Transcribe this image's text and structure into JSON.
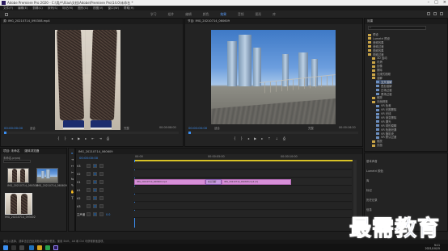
{
  "window": {
    "title": "Adobe Premiere Pro 2020 - C:\\用户\\Xiao\\文档\\Adobe\\Premiere Pro\\14.0\\未命名 *"
  },
  "menu": [
    "文件(F)",
    "编辑(E)",
    "剪辑(C)",
    "序列(S)",
    "标记(M)",
    "图形(G)",
    "视图(V)",
    "窗口(W)",
    "帮助(H)"
  ],
  "workspaces": {
    "tabs": [
      "学习",
      "组件",
      "编辑",
      "颜色",
      "效果",
      "音频",
      "图形",
      "库"
    ],
    "active_index": 4
  },
  "source_monitor": {
    "header": "源: IMG_20210714_090308.mp4",
    "timecode": "00:00:00:00",
    "fit_label": "适合",
    "quality_label": "完整",
    "duration": "00:00:08:00",
    "accent": "#3b8ef0"
  },
  "program_monitor": {
    "header": "节目: IMG_20210714_060609",
    "timecode": "00:00:00:00",
    "fit_label": "适合",
    "quality_label": "完整",
    "duration": "00:00:16:20"
  },
  "project_panel": {
    "tabs": [
      "项目: 未命名",
      "媒体浏览器"
    ],
    "path": "未命名.prproj",
    "items": [
      {
        "name": "IMG_20210714_060609",
        "duration": "9:08"
      },
      {
        "name": "IMG_20210714_090308",
        "duration": "8:00"
      },
      {
        "name": "IMG_20210714_093002",
        "duration": "6:20"
      }
    ]
  },
  "tools": [
    "▸",
    "⇥",
    "↔",
    "✂",
    "⇆",
    "✎",
    "✋",
    "T"
  ],
  "timeline": {
    "tab": "IMG_20210714_060609",
    "timecode": "00:00:00:00",
    "ruler_labels": [
      "00:00",
      "00:00:05:00",
      "00:00:10:00"
    ],
    "tracks": [
      {
        "label": "V3",
        "type": "video"
      },
      {
        "label": "V2",
        "type": "video"
      },
      {
        "label": "V1",
        "type": "video"
      },
      {
        "label": "A1",
        "type": "audio"
      },
      {
        "label": "A2",
        "type": "audio"
      },
      {
        "label": "A3",
        "type": "audio"
      },
      {
        "label": "主声道",
        "type": "master",
        "value": "0.0"
      }
    ],
    "clips": [
      {
        "track": "V1",
        "name": "IMG_20210714_060609.mp4"
      },
      {
        "track": "V1",
        "name": "交叉溶解"
      },
      {
        "track": "V1",
        "name": "IMG_20210714_090308.mp4 [V]"
      }
    ],
    "clip_color": "#d78fd8"
  },
  "effects_panel": {
    "header": "效果",
    "items": [
      {
        "label": "预设",
        "depth": 0
      },
      {
        "label": "Lumetri 预设",
        "depth": 0
      },
      {
        "label": "音频效果",
        "depth": 0
      },
      {
        "label": "音频过渡",
        "depth": 0
      },
      {
        "label": "视频效果",
        "depth": 0
      },
      {
        "label": "视频过渡",
        "depth": 0
      },
      {
        "label": "3D 运动",
        "depth": 1
      },
      {
        "label": "内滑",
        "depth": 1
      },
      {
        "label": "划像",
        "depth": 1
      },
      {
        "label": "擦除",
        "depth": 1
      },
      {
        "label": "沉浸式视频",
        "depth": 1
      },
      {
        "label": "溶解",
        "depth": 1
      },
      {
        "label": "交叉溶解",
        "depth": 2,
        "selected": true
      },
      {
        "label": "叠加溶解",
        "depth": 2
      },
      {
        "label": "白场过渡",
        "depth": 2
      },
      {
        "label": "黑场过渡",
        "depth": 2
      },
      {
        "label": "缩放",
        "depth": 1
      },
      {
        "label": "页面剥落",
        "depth": 1
      },
      {
        "label": "VR 色差",
        "depth": 2
      },
      {
        "label": "VR 光圈擦除",
        "depth": 2
      },
      {
        "label": "VR 光线",
        "depth": 2
      },
      {
        "label": "VR 渐变擦除",
        "depth": 2
      },
      {
        "label": "VR 漏光",
        "depth": 2
      },
      {
        "label": "VR 球形模糊",
        "depth": 2
      },
      {
        "label": "VR 色度泄漏",
        "depth": 2
      },
      {
        "label": "VR 随机块",
        "depth": 2
      },
      {
        "label": "VR 默认过渡",
        "depth": 2
      },
      {
        "label": "缩放",
        "depth": 1
      },
      {
        "label": "页面",
        "depth": 1
      },
      {
        "label": "效果控件",
        "depth": 0
      },
      {
        "label": "基本图形",
        "depth": 0
      }
    ],
    "lower": [
      "基本声音",
      "Lumetri 颜色",
      "库",
      "标记",
      "历史记录",
      "信息"
    ]
  },
  "statusbar": {
    "text": "单击以选择，或单击空白处并拖动以进行框选。使用 Shift、Alt 和 Ctrl 可获得其他选项。"
  },
  "taskbar": {
    "time": "9:11",
    "date": "2021/10/15"
  },
  "watermark": {
    "text": "最需教育"
  }
}
